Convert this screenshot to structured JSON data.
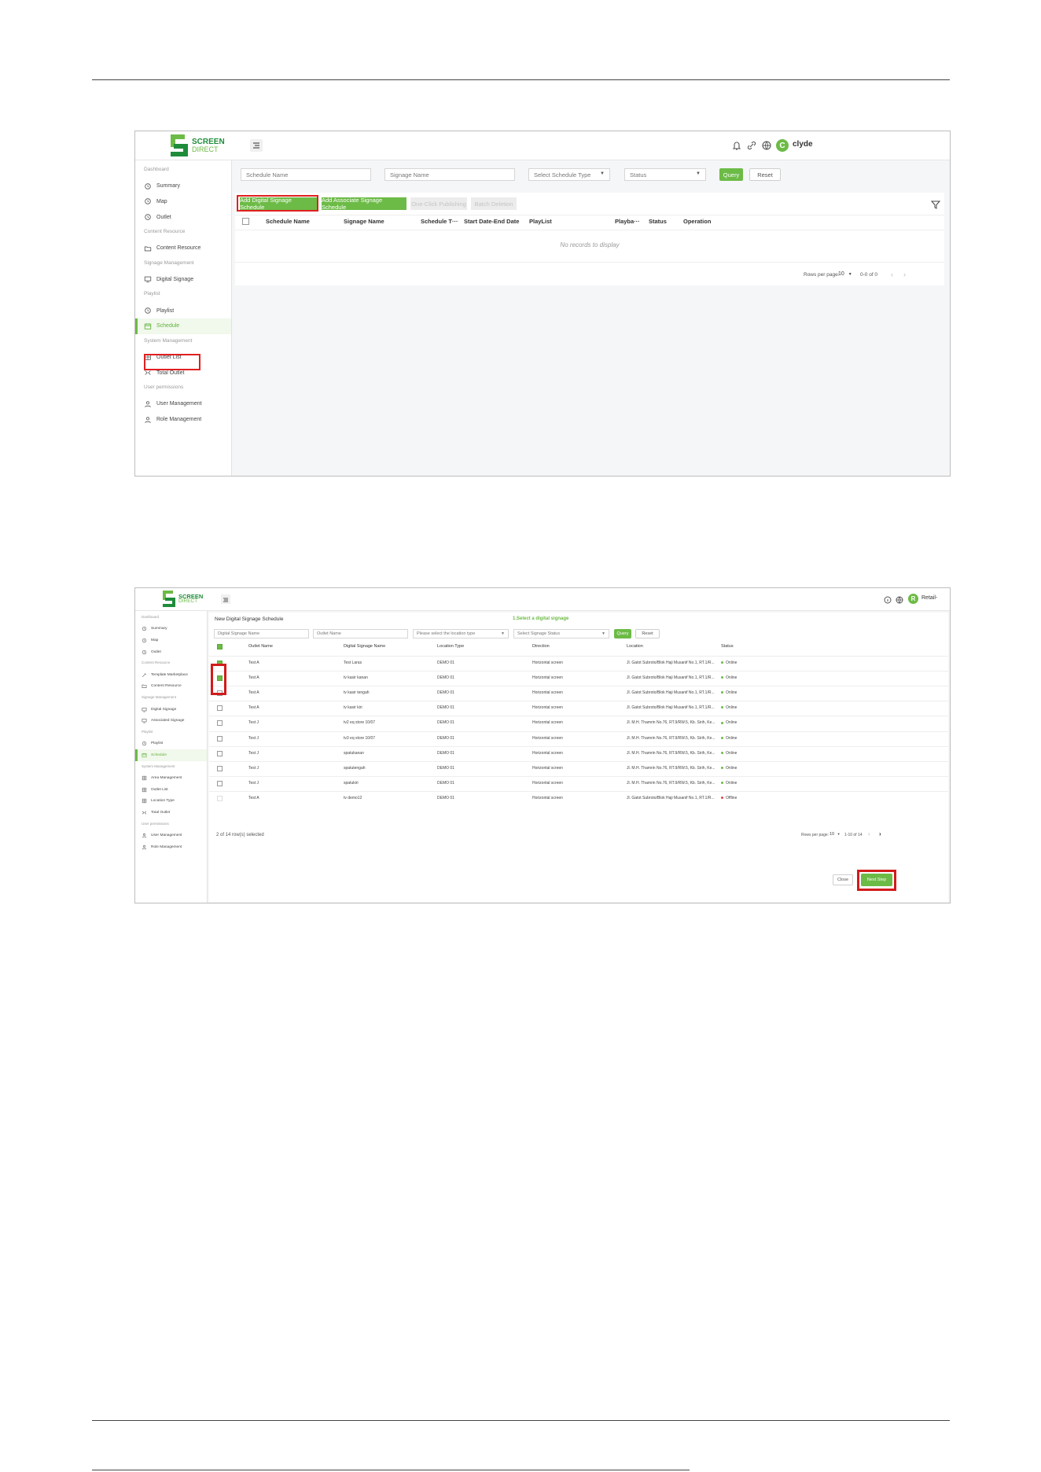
{
  "shot1": {
    "logo": {
      "brand": "SCREEN",
      "sub": "DIRECT"
    },
    "user": {
      "avatar_letter": "C",
      "name": "clyde"
    },
    "sidebar": [
      {
        "type": "section",
        "label": "Dashboard"
      },
      {
        "type": "item",
        "label": "Summary",
        "icon": "clock-icon"
      },
      {
        "type": "item",
        "label": "Map",
        "icon": "clock-icon"
      },
      {
        "type": "item",
        "label": "Outlet",
        "icon": "clock-icon"
      },
      {
        "type": "section",
        "label": "Content Resource"
      },
      {
        "type": "item",
        "label": "Content Resource",
        "icon": "folder-icon"
      },
      {
        "type": "section",
        "label": "Signage Management"
      },
      {
        "type": "item",
        "label": "Digital Signage",
        "icon": "monitor-icon"
      },
      {
        "type": "section",
        "label": "Playlist"
      },
      {
        "type": "item",
        "label": "Playlist",
        "icon": "clock-icon"
      },
      {
        "type": "item",
        "label": "Schedule",
        "icon": "schedule-icon",
        "active": true
      },
      {
        "type": "section",
        "label": "System Management"
      },
      {
        "type": "item",
        "label": "Outlet List",
        "icon": "grid-icon"
      },
      {
        "type": "item",
        "label": "Total Outlet",
        "icon": "split-icon"
      },
      {
        "type": "section",
        "label": "User permissions"
      },
      {
        "type": "item",
        "label": "User Management",
        "icon": "user-icon"
      },
      {
        "type": "item",
        "label": "Role Management",
        "icon": "user-icon"
      }
    ],
    "filters": {
      "schedule_name_placeholder": "Schedule Name",
      "signage_name_placeholder": "Signage Name",
      "schedule_type_placeholder": "Select Schedule Type",
      "status_placeholder": "Status",
      "query": "Query",
      "reset": "Reset"
    },
    "actions": {
      "add_digital": "Add Digital Signage Schedule",
      "add_associate": "Add Associate Signage Schedule",
      "one_click": "One-Click Publishing",
      "batch": "Batch Deletion"
    },
    "columns": [
      "Schedule Name",
      "Signage Name",
      "Schedule T···",
      "Start Date-End Date",
      "PlayList",
      "Playba···",
      "Status",
      "Operation"
    ],
    "empty_text": "No records to display",
    "pagination": {
      "rows_label": "Rows per page:",
      "rows_value": "10",
      "range": "0-0 of 0"
    }
  },
  "shot2": {
    "logo": {
      "brand": "SCREEN",
      "sub": "DIRECT"
    },
    "user": {
      "avatar_letter": "R",
      "name": "Retail-"
    },
    "sidebar": [
      {
        "type": "section",
        "label": "Dashboard"
      },
      {
        "type": "item",
        "label": "Summary",
        "icon": "clock-icon"
      },
      {
        "type": "item",
        "label": "Map",
        "icon": "clock-icon"
      },
      {
        "type": "item",
        "label": "Outlet",
        "icon": "clock-icon"
      },
      {
        "type": "section",
        "label": "Content Resource"
      },
      {
        "type": "item",
        "label": "Template Marketplace",
        "icon": "wand-icon"
      },
      {
        "type": "item",
        "label": "Content Resource",
        "icon": "folder-icon"
      },
      {
        "type": "section",
        "label": "Signage Management"
      },
      {
        "type": "item",
        "label": "Digital Signage",
        "icon": "monitor-icon"
      },
      {
        "type": "item",
        "label": "Associated Signage",
        "icon": "monitor-icon"
      },
      {
        "type": "section",
        "label": "Playlist"
      },
      {
        "type": "item",
        "label": "Playlist",
        "icon": "clock-icon"
      },
      {
        "type": "item",
        "label": "Schedule",
        "icon": "schedule-icon",
        "active": true
      },
      {
        "type": "section",
        "label": "System Management"
      },
      {
        "type": "item",
        "label": "Area Management",
        "icon": "grid-icon"
      },
      {
        "type": "item",
        "label": "Outlet List",
        "icon": "grid-icon"
      },
      {
        "type": "item",
        "label": "Location Type",
        "icon": "grid-icon"
      },
      {
        "type": "item",
        "label": "Total Outlet",
        "icon": "split-icon"
      },
      {
        "type": "section",
        "label": "User permissions"
      },
      {
        "type": "item",
        "label": "User Management",
        "icon": "user-icon"
      },
      {
        "type": "item",
        "label": "Role Management",
        "icon": "user-icon"
      }
    ],
    "title": "New Digital Signage Schedule",
    "step": "1.Select a digital signage",
    "filters": {
      "signage_name_placeholder": "Digital Signage Name",
      "outlet_name_placeholder": "Outlet Name",
      "location_type_placeholder": "Please select the location type",
      "status_placeholder": "Select Signage Status",
      "query": "Query",
      "reset": "Reset"
    },
    "columns": [
      "Outlet Name",
      "Digital Signage Name",
      "Location Type",
      "Direction",
      "Location",
      "Status"
    ],
    "rows": [
      {
        "checked": true,
        "outlet": "Test A",
        "name": "Test Laras",
        "loc_type": "DEMO 01",
        "direction": "Horizontal screen",
        "location": "Jl. Gatot Subroto/Blok Haji Musanif No.1, RT.1/R...",
        "status": "Online"
      },
      {
        "checked": true,
        "outlet": "Test A",
        "name": "tv kasir kanan",
        "loc_type": "DEMO 01",
        "direction": "Horizontal screen",
        "location": "Jl. Gatot Subroto/Blok Haji Musanif No.1, RT.1/R...",
        "status": "Online"
      },
      {
        "checked": false,
        "outlet": "Test A",
        "name": "tv kasir tengah",
        "loc_type": "DEMO 01",
        "direction": "Horizontal screen",
        "location": "Jl. Gatot Subroto/Blok Haji Musanif No.1, RT.1/R...",
        "status": "Online"
      },
      {
        "checked": false,
        "outlet": "Test A",
        "name": "tv kasir kiri",
        "loc_type": "DEMO 01",
        "direction": "Horizontal screen",
        "location": "Jl. Gatot Subroto/Blok Haji Musanif No.1, RT.1/R...",
        "status": "Online"
      },
      {
        "checked": false,
        "outlet": "Test J",
        "name": "tv2 eq store 10/07",
        "loc_type": "DEMO 01",
        "direction": "Horizontal screen",
        "location": "Jl. M.H. Thamrin No.76, RT.9/RW.5, Kb. Sirih, Ke...",
        "status": "Online"
      },
      {
        "checked": false,
        "outlet": "Test J",
        "name": "tv3 eq store 10/07",
        "loc_type": "DEMO 01",
        "direction": "Horizontal screen",
        "location": "Jl. M.H. Thamrin No.76, RT.9/RW.5, Kb. Sirih, Ke...",
        "status": "Online"
      },
      {
        "checked": false,
        "outlet": "Test J",
        "name": "spatukanan",
        "loc_type": "DEMO 01",
        "direction": "Horizontal screen",
        "location": "Jl. M.H. Thamrin No.76, RT.9/RW.5, Kb. Sirih, Ke...",
        "status": "Online"
      },
      {
        "checked": false,
        "outlet": "Test J",
        "name": "spatutengah",
        "loc_type": "DEMO 01",
        "direction": "Horizontal screen",
        "location": "Jl. M.H. Thamrin No.76, RT.9/RW.5, Kb. Sirih, Ke...",
        "status": "Online"
      },
      {
        "checked": false,
        "outlet": "Test J",
        "name": "spatukiri",
        "loc_type": "DEMO 01",
        "direction": "Horizontal screen",
        "location": "Jl. M.H. Thamrin No.76, RT.9/RW.5, Kb. Sirih, Ke...",
        "status": "Online"
      },
      {
        "checked": false,
        "disabled": true,
        "outlet": "Test A",
        "name": "tv demo12",
        "loc_type": "DEMO 01",
        "direction": "Horizontal screen",
        "location": "Jl. Gatot Subroto/Blok Haji Musanif No.1, RT.1/R...",
        "status": "Offline"
      }
    ],
    "selected_text": "2 of 14 row(s) selected",
    "pagination": {
      "rows_label": "Rows per page:",
      "rows_value": "10",
      "range": "1-10 of 14"
    },
    "buttons": {
      "close": "Close",
      "next": "Next Step"
    }
  },
  "colors": {
    "accent": "#6cbb46",
    "dark_green": "#1f8c3b",
    "highlight_red": "#e02020",
    "online": "#6cbb46",
    "offline": "#e04848"
  }
}
